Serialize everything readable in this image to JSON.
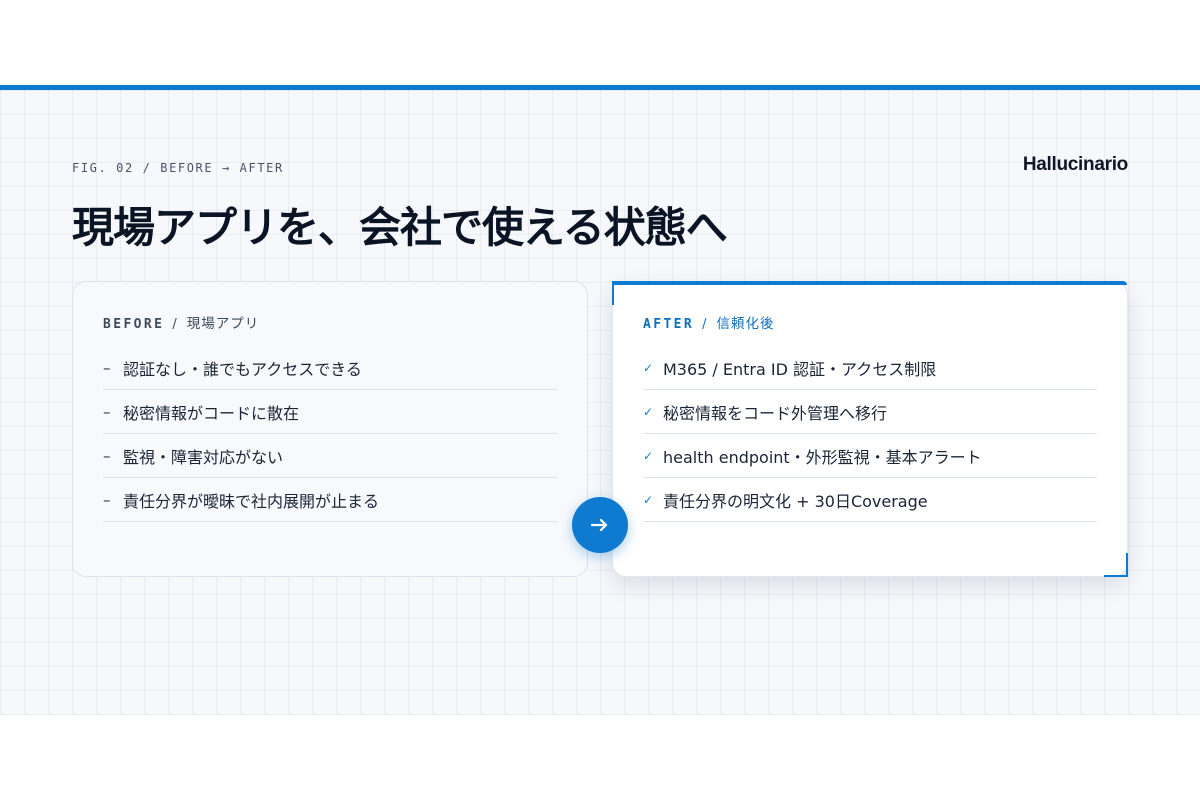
{
  "figure_label": "FIG. 02 / BEFORE → AFTER",
  "brand": "Hallucinario",
  "title": "現場アプリを、会社で使える状態へ",
  "before": {
    "keyword": "BEFORE",
    "separator": "/",
    "subtitle": "現場アプリ",
    "marker": "–",
    "items": [
      "認証なし・誰でもアクセスできる",
      "秘密情報がコードに散在",
      "監視・障害対応がない",
      "責任分界が曖昧で社内展開が止まる"
    ]
  },
  "after": {
    "keyword": "AFTER",
    "separator": "/",
    "subtitle": "信頼化後",
    "marker": "✓",
    "items": [
      "M365 / Entra ID 認証・アクセス制限",
      "秘密情報をコード外管理へ移行",
      "health endpoint・外形監視・基本アラート",
      "責任分界の明文化 + 30日Coverage"
    ]
  },
  "colors": {
    "accent": "#0f7bd0",
    "title": "#0b1424",
    "background": "#f6f8fb"
  },
  "icons": {
    "transition": "arrow-right-icon",
    "check": "check-icon",
    "dash": "dash-icon"
  }
}
